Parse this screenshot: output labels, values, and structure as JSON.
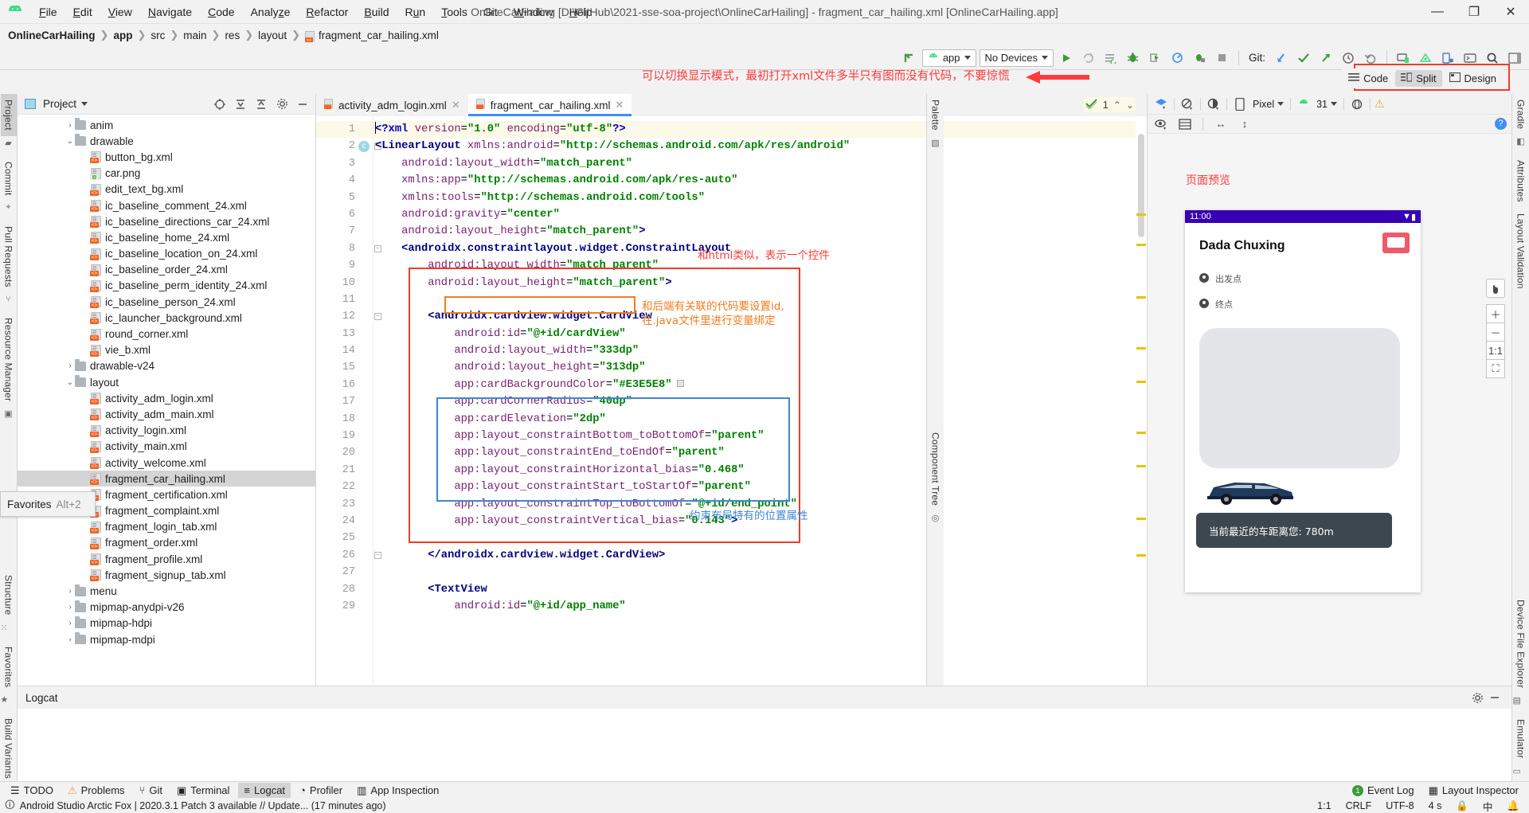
{
  "window": {
    "title": "OnlineCarHailing [D:\\GitHub\\2021-sse-soa-project\\OnlineCarHailing] - fragment_car_hailing.xml [OnlineCarHailing.app]",
    "minimize": "—",
    "maximize": "❐",
    "close": "✕"
  },
  "menu": [
    {
      "label": "File"
    },
    {
      "label": "Edit"
    },
    {
      "label": "View"
    },
    {
      "label": "Navigate"
    },
    {
      "label": "Code"
    },
    {
      "label": "Analyze"
    },
    {
      "label": "Refactor"
    },
    {
      "label": "Build"
    },
    {
      "label": "Run"
    },
    {
      "label": "Tools"
    },
    {
      "label": "Git"
    },
    {
      "label": "Window"
    },
    {
      "label": "Help"
    }
  ],
  "breadcrumb": [
    "OnlineCarHailing",
    "app",
    "src",
    "main",
    "res",
    "layout",
    "fragment_car_hailing.xml"
  ],
  "toolbar": {
    "module_selector": "app",
    "device_selector": "No Devices",
    "git_label": "Git:"
  },
  "left_rail": {
    "top": [
      "Project",
      "Commit",
      "Pull Requests",
      "Resource Manager"
    ],
    "bottom": [
      "Structure",
      "Favorites",
      "Build Variants"
    ]
  },
  "right_rail": {
    "top": [
      "Gradle",
      "Attributes",
      "Layout Validation"
    ],
    "bottom": [
      "Device File Explorer",
      "Emulator"
    ]
  },
  "project_panel": {
    "title": "Project",
    "tree": [
      {
        "indent": 3,
        "arrow": "›",
        "type": "folder",
        "label": "anim"
      },
      {
        "indent": 3,
        "arrow": "⌄",
        "type": "folder",
        "label": "drawable"
      },
      {
        "indent": 4,
        "arrow": "",
        "type": "xml",
        "label": "button_bg.xml"
      },
      {
        "indent": 4,
        "arrow": "",
        "type": "png",
        "label": "car.png"
      },
      {
        "indent": 4,
        "arrow": "",
        "type": "xml",
        "label": "edit_text_bg.xml"
      },
      {
        "indent": 4,
        "arrow": "",
        "type": "xml",
        "label": "ic_baseline_comment_24.xml"
      },
      {
        "indent": 4,
        "arrow": "",
        "type": "xml",
        "label": "ic_baseline_directions_car_24.xml"
      },
      {
        "indent": 4,
        "arrow": "",
        "type": "xml",
        "label": "ic_baseline_home_24.xml"
      },
      {
        "indent": 4,
        "arrow": "",
        "type": "xml",
        "label": "ic_baseline_location_on_24.xml"
      },
      {
        "indent": 4,
        "arrow": "",
        "type": "xml",
        "label": "ic_baseline_order_24.xml"
      },
      {
        "indent": 4,
        "arrow": "",
        "type": "xml",
        "label": "ic_baseline_perm_identity_24.xml"
      },
      {
        "indent": 4,
        "arrow": "",
        "type": "xml",
        "label": "ic_baseline_person_24.xml"
      },
      {
        "indent": 4,
        "arrow": "",
        "type": "xml",
        "label": "ic_launcher_background.xml"
      },
      {
        "indent": 4,
        "arrow": "",
        "type": "xml",
        "label": "round_corner.xml"
      },
      {
        "indent": 4,
        "arrow": "",
        "type": "xml",
        "label": "vie_b.xml"
      },
      {
        "indent": 3,
        "arrow": "›",
        "type": "folder",
        "label": "drawable-v24"
      },
      {
        "indent": 3,
        "arrow": "⌄",
        "type": "folder",
        "label": "layout"
      },
      {
        "indent": 4,
        "arrow": "",
        "type": "xml",
        "label": "activity_adm_login.xml"
      },
      {
        "indent": 4,
        "arrow": "",
        "type": "xml",
        "label": "activity_adm_main.xml"
      },
      {
        "indent": 4,
        "arrow": "",
        "type": "xml",
        "label": "activity_login.xml"
      },
      {
        "indent": 4,
        "arrow": "",
        "type": "xml",
        "label": "activity_main.xml"
      },
      {
        "indent": 4,
        "arrow": "",
        "type": "xml",
        "label": "activity_welcome.xml"
      },
      {
        "indent": 4,
        "arrow": "",
        "type": "xml",
        "label": "fragment_car_hailing.xml",
        "selected": true
      },
      {
        "indent": 4,
        "arrow": "",
        "type": "xml",
        "label": "fragment_certification.xml"
      },
      {
        "indent": 4,
        "arrow": "",
        "type": "xml",
        "label": "fragment_complaint.xml"
      },
      {
        "indent": 4,
        "arrow": "",
        "type": "xml",
        "label": "fragment_login_tab.xml"
      },
      {
        "indent": 4,
        "arrow": "",
        "type": "xml",
        "label": "fragment_order.xml"
      },
      {
        "indent": 4,
        "arrow": "",
        "type": "xml",
        "label": "fragment_profile.xml"
      },
      {
        "indent": 4,
        "arrow": "",
        "type": "xml",
        "label": "fragment_signup_tab.xml"
      },
      {
        "indent": 3,
        "arrow": "›",
        "type": "folder",
        "label": "menu"
      },
      {
        "indent": 3,
        "arrow": "›",
        "type": "folder",
        "label": "mipmap-anydpi-v26"
      },
      {
        "indent": 3,
        "arrow": "›",
        "type": "folder",
        "label": "mipmap-hdpi"
      },
      {
        "indent": 3,
        "arrow": "›",
        "type": "folder",
        "label": "mipmap-mdpi"
      }
    ]
  },
  "favorites_tooltip": {
    "label": "Favorites",
    "shortcut": "Alt+2"
  },
  "editor": {
    "tabs": [
      {
        "label": "activity_adm_login.xml",
        "active": false
      },
      {
        "label": "fragment_car_hailing.xml",
        "active": true
      }
    ],
    "inspection_count": "1",
    "first_line_number": 1,
    "lines": [
      {
        "n": 1,
        "marker": "",
        "fold": false,
        "current": true,
        "html": "<span class='caret-bar'></span><span class='t-proc'>&lt;?xml </span><span class='t-attr'>version</span><span class='t-eq'>=</span><span class='t-str'>\"1.0\"</span><span class='t-attr'> encoding</span><span class='t-eq'>=</span><span class='t-str'>\"utf-8\"</span><span class='t-proc'>?&gt;</span>"
      },
      {
        "n": 2,
        "marker": "c",
        "fold": true,
        "html": "<span class='t-tag'>&lt;LinearLayout</span> <span class='t-attr'>xmlns:android</span><span class='t-eq'>=</span><span class='t-str'>\"http://schemas.android.com/apk/res/android\"</span>"
      },
      {
        "n": 3,
        "marker": "",
        "fold": false,
        "html": "    <span class='t-attr'>android:layout_width</span><span class='t-eq'>=</span><span class='t-str'>\"match_parent\"</span>"
      },
      {
        "n": 4,
        "marker": "",
        "fold": false,
        "html": "    <span class='t-attr'>xmlns:app</span><span class='t-eq'>=</span><span class='t-str'>\"http://schemas.android.com/apk/res-auto\"</span>"
      },
      {
        "n": 5,
        "marker": "",
        "fold": false,
        "html": "    <span class='t-attr'>xmlns:tools</span><span class='t-eq'>=</span><span class='t-str'>\"http://schemas.android.com/tools\"</span>"
      },
      {
        "n": 6,
        "marker": "",
        "fold": false,
        "html": "    <span class='t-attr'>android:gravity</span><span class='t-eq'>=</span><span class='t-str'>\"center\"</span>"
      },
      {
        "n": 7,
        "marker": "",
        "fold": false,
        "html": "    <span class='t-attr'>android:layout_height</span><span class='t-eq'>=</span><span class='t-str'>\"match_parent\"</span><span class='t-tag'>&gt;</span>"
      },
      {
        "n": 8,
        "marker": "",
        "fold": true,
        "html": "    <span class='t-tag'>&lt;androidx.constraintlayout.widget.ConstraintLayout</span>"
      },
      {
        "n": 9,
        "marker": "",
        "fold": false,
        "html": "        <span class='t-attr'>android:layout_width</span><span class='t-eq'>=</span><span class='t-str'>\"match_parent\"</span>"
      },
      {
        "n": 10,
        "marker": "",
        "fold": false,
        "html": "        <span class='t-attr'>android:layout_height</span><span class='t-eq'>=</span><span class='t-str'>\"match_parent\"</span><span class='t-tag'>&gt;</span>"
      },
      {
        "n": 11,
        "marker": "",
        "fold": false,
        "html": ""
      },
      {
        "n": 12,
        "marker": "",
        "fold": true,
        "html": "        <span class='t-tag'>&lt;androidx.cardview.widget.CardView</span>"
      },
      {
        "n": 13,
        "marker": "",
        "fold": false,
        "html": "            <span class='t-attr'>android:id</span><span class='t-eq'>=</span><span class='t-str'>\"@+id/cardView\"</span>"
      },
      {
        "n": 14,
        "marker": "",
        "fold": false,
        "html": "            <span class='t-attr'>android:layout_width</span><span class='t-eq'>=</span><span class='t-str'>\"333dp\"</span>"
      },
      {
        "n": 15,
        "marker": "",
        "fold": false,
        "html": "            <span class='t-attr'>android:layout_height</span><span class='t-eq'>=</span><span class='t-str'>\"313dp\"</span>"
      },
      {
        "n": 16,
        "marker": "",
        "fold": false,
        "swatch": true,
        "html": "            <span class='t-attr'>app:cardBackgroundColor</span><span class='t-eq'>=</span><span class='t-str'>\"#E3E5E8\"</span>"
      },
      {
        "n": 17,
        "marker": "",
        "fold": false,
        "html": "            <span class='t-attr'>app:cardCornerRadius</span><span class='t-eq'>=</span><span class='t-str'>\"40dp\"</span>"
      },
      {
        "n": 18,
        "marker": "",
        "fold": false,
        "html": "            <span class='t-attr'>app:cardElevation</span><span class='t-eq'>=</span><span class='t-str'>\"2dp\"</span>"
      },
      {
        "n": 19,
        "marker": "",
        "fold": false,
        "html": "            <span class='t-attr'>app:layout_constraintBottom_toBottomOf</span><span class='t-eq'>=</span><span class='t-str'>\"parent\"</span>"
      },
      {
        "n": 20,
        "marker": "",
        "fold": false,
        "html": "            <span class='t-attr'>app:layout_constraintEnd_toEndOf</span><span class='t-eq'>=</span><span class='t-str'>\"parent\"</span>"
      },
      {
        "n": 21,
        "marker": "",
        "fold": false,
        "html": "            <span class='t-attr'>app:layout_constraintHorizontal_bias</span><span class='t-eq'>=</span><span class='t-str'>\"0.468\"</span>"
      },
      {
        "n": 22,
        "marker": "",
        "fold": false,
        "html": "            <span class='t-attr'>app:layout_constraintStart_toStartOf</span><span class='t-eq'>=</span><span class='t-str'>\"parent\"</span>"
      },
      {
        "n": 23,
        "marker": "",
        "fold": false,
        "html": "            <span class='t-attr'>app:layout_constraintTop_toBottomOf</span><span class='t-eq'>=</span><span class='t-str'>\"@+id/end_point\"</span>"
      },
      {
        "n": 24,
        "marker": "",
        "fold": false,
        "html": "            <span class='t-attr'>app:layout_constraintVertical_bias</span><span class='t-eq'>=</span><span class='t-str'>\"0.143\"</span><span class='t-tag'>&gt;</span>"
      },
      {
        "n": 25,
        "marker": "",
        "fold": false,
        "html": ""
      },
      {
        "n": 26,
        "marker": "",
        "fold": true,
        "html": "        <span class='t-tag'>&lt;/androidx.cardview.widget.CardView&gt;</span>"
      },
      {
        "n": 27,
        "marker": "",
        "fold": false,
        "html": ""
      },
      {
        "n": 28,
        "marker": "",
        "fold": false,
        "html": "        <span class='t-tag'>&lt;TextView</span>"
      },
      {
        "n": 29,
        "marker": "",
        "fold": false,
        "html": "            <span class='t-attr'>android:id</span><span class='t-eq'>=</span><span class='t-str'>\"@+id/app_name\"</span>"
      }
    ]
  },
  "annotations": {
    "top_hint": "可以切换显示模式，最初打开xml文件多半只有图而没有代码，不要惊慌",
    "widget_note": "和html类似，表示一个控件",
    "id_note_line1": "和后端有关联的代码要设置id,",
    "id_note_line2": "在.java文件里进行变量绑定",
    "constraint_note": "约束布局特有的位置属性",
    "preview_note": "页面预览"
  },
  "mode_switch": {
    "options": [
      {
        "label": "Code",
        "selected": false
      },
      {
        "label": "Split",
        "selected": true
      },
      {
        "label": "Design",
        "selected": false
      }
    ]
  },
  "design_panel": {
    "device": "Pixel",
    "api_level": "31",
    "preview": {
      "status_time": "11:00",
      "app_title": "Dada Chuxing",
      "start_point": "出发点",
      "end_point": "终点",
      "toast": "当前最近的车距离您: 780m"
    },
    "zoom_label": "1:1"
  },
  "logcat": {
    "title": "Logcat"
  },
  "tool_windows": {
    "left": [
      {
        "label": "TODO",
        "icon": "list-icon"
      },
      {
        "label": "Problems",
        "icon": "warning-icon"
      },
      {
        "label": "Git",
        "icon": "git-icon"
      },
      {
        "label": "Terminal",
        "icon": "terminal-icon"
      },
      {
        "label": "Logcat",
        "icon": "logcat-icon",
        "selected": true
      },
      {
        "label": "Profiler",
        "icon": "profiler-icon"
      },
      {
        "label": "App Inspection",
        "icon": "inspection-icon"
      }
    ],
    "right": [
      {
        "label": "Event Log",
        "badge": "1"
      },
      {
        "label": "Layout Inspector",
        "icon": "layout-inspector-icon"
      }
    ]
  },
  "status_bar": {
    "message": "Android Studio Arctic Fox | 2020.3.1 Patch 3 available // Update... (17 minutes ago)",
    "position": "1:1",
    "line_sep": "CRLF",
    "encoding": "UTF-8",
    "indent": "4 s",
    "lang": "中",
    "lock": "lock-icon"
  },
  "colors": {
    "accent_blue": "#3f8ff5",
    "red": "#ef3b2d",
    "orange": "#f07c1e",
    "box_blue": "#3f86d6",
    "android_green": "#3ddc84",
    "card_bg": "#E3E5E8",
    "status_purple": "#3700b3"
  }
}
